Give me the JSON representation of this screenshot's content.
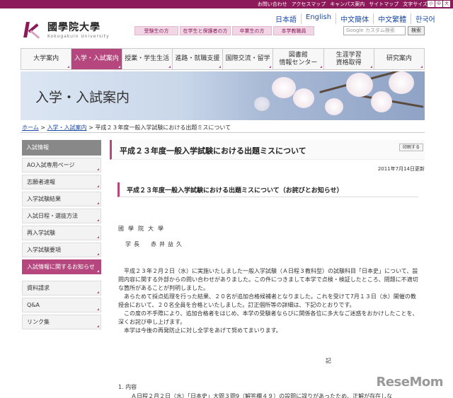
{
  "util": {
    "links": [
      "お問い合わせ",
      "アクセスマップ",
      "キャンパス案内",
      "サイトマップ",
      "文字サイズ"
    ],
    "sizes": [
      "小",
      "中",
      "大"
    ]
  },
  "logo": {
    "jp": "國學院大學",
    "en": "Kokugakuin University"
  },
  "langs": [
    "日本語",
    "English",
    "中文簡体",
    "中文繁體",
    "한국어"
  ],
  "aud_tabs": [
    "受験生の方",
    "在学生と保護者の方",
    "卒業生の方",
    "本学教職員"
  ],
  "search": {
    "placeholder": "Google カスタム検索",
    "button": "検索"
  },
  "mainnav": [
    "大学案内",
    "入学・入試案内",
    "授業・学生生活",
    "進路・就職支援",
    "国際交流・留学",
    "図書館\n情報センター",
    "生涯学習\n資格取得",
    "研究案内"
  ],
  "hero_title": "入学・入試案内",
  "breadcrumb": {
    "home": "ホーム",
    "sep": " > ",
    "section": "入学・入試案内",
    "current": "平成２３年度一般入学試験における出題ミスについて"
  },
  "sidenav": {
    "header": "入試情報",
    "items": [
      "AO入試専用ページ",
      "志願者速報",
      "入学試験結果",
      "入試日程・選抜方法",
      "再入学試験",
      "入学試験要項",
      "入試情報に関するお知らせ"
    ],
    "items2": [
      "資料請求",
      "Q&A",
      "リンク集"
    ]
  },
  "content": {
    "title": "平成２３年度一般入学試験における出題ミスについて",
    "print": "印刷する",
    "updated": "2011年7月14日更新",
    "subtitle": "平成２３年度一般入学試験における出題ミスについて（お詫びとお知らせ）",
    "sign1": "國學院大學",
    "sign2": "学長　赤井益久",
    "paragraphs": [
      "平成２３年２月２日（水）に実施いたしました一般入学試験（Ａ日程３教科型）の試験科目「日本史」について、設問内容に関する外部からの問い合わせがありました。この件につきまして本学で点検・検証したところ、問題に不適切な箇所があることが判明しました。",
      "あらためて採点処理を行った結果、２０名が追加合格候補者となりました。これを受けて7月１３日（水）開催の教授会において、２０名全員を合格といたしました。訂正個所等の詳細は、下記のとおりです。",
      "この度の不手際により、追加合格者をはじめ、本学の受験者ならびに関係各位に多大なご迷惑をおかけしたことを、深くお詫び申し上げます。",
      "本学は今後の再発防止に対し全学をあげて努めてまいります。"
    ],
    "ki": "記",
    "item1": "1. 内容",
    "item1b": "Ａ日程２月２日（水）「日本史」大問３問9（解答欄４９）の設問に誤りがあったため、正解が存在しな"
  },
  "watermark": "ReseMom"
}
